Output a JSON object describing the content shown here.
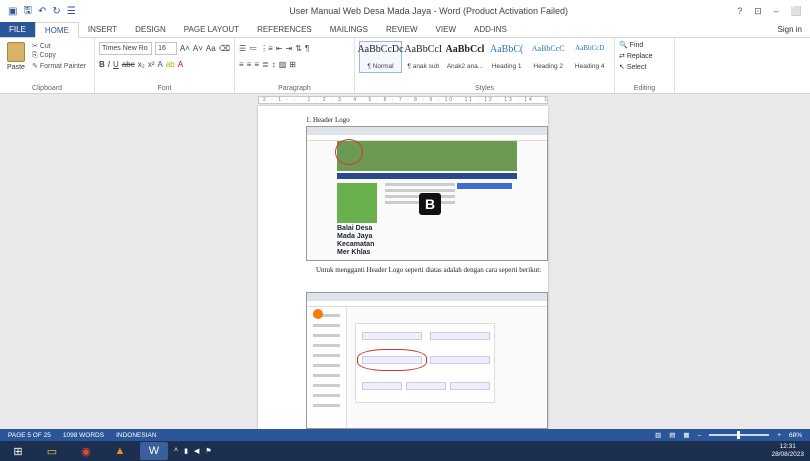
{
  "window": {
    "title": "User Manual Web Desa Mada Jaya - Word (Product Activation Failed)",
    "controls": [
      "?",
      "⊡",
      "–",
      "⬜"
    ]
  },
  "tabs": [
    "FILE",
    "HOME",
    "INSERT",
    "DESIGN",
    "PAGE LAYOUT",
    "REFERENCES",
    "MAILINGS",
    "REVIEW",
    "VIEW",
    "ADD-INS"
  ],
  "signin": "Sign in",
  "clipboard": {
    "paste": "Paste",
    "cut": "Cut",
    "copy": "Copy",
    "format_painter": "Format Painter",
    "label": "Clipboard"
  },
  "font": {
    "name": "Times New Ro",
    "size": "16",
    "label": "Font"
  },
  "paragraph": {
    "label": "Paragraph"
  },
  "styles": {
    "label": "Styles",
    "items": [
      {
        "preview": "AaBbCcDc",
        "name": "¶ Normal"
      },
      {
        "preview": "AaBbCcI",
        "name": "¶ anak sub"
      },
      {
        "preview": "AaBbCcl",
        "name": "Anak2 ana..."
      },
      {
        "preview": "AaBbC(",
        "name": "Heading 1"
      },
      {
        "preview": "AaBbCcC",
        "name": "Heading 2"
      },
      {
        "preview": "AaBbCcD",
        "name": "Heading 4"
      }
    ]
  },
  "editing": {
    "find": "Find",
    "replace": "Replace",
    "select": "Select",
    "label": "Editing"
  },
  "ruler_text": "2 · 1 · · · 1 · 2 · 3 · 4 · 5 · 6 · 7 · 8 · 9 · 10 · 11 · 12 · 13 · 14 · 15 · 16 · 17 · 18",
  "document": {
    "heading": "1.   Header Logo",
    "caption": "Untuk mengganti Header Logo seperti diatas adalah dengan cara seperti berikut:",
    "shot1_text": "Balai Desa Mada Jaya Kecamatan Mer Khlas"
  },
  "status": {
    "page": "PAGE 5 OF 25",
    "words": "1098 WORDS",
    "lang": "INDONESIAN",
    "zoom": "68%"
  },
  "clock": {
    "time": "12:31",
    "date": "28/08/2023"
  }
}
